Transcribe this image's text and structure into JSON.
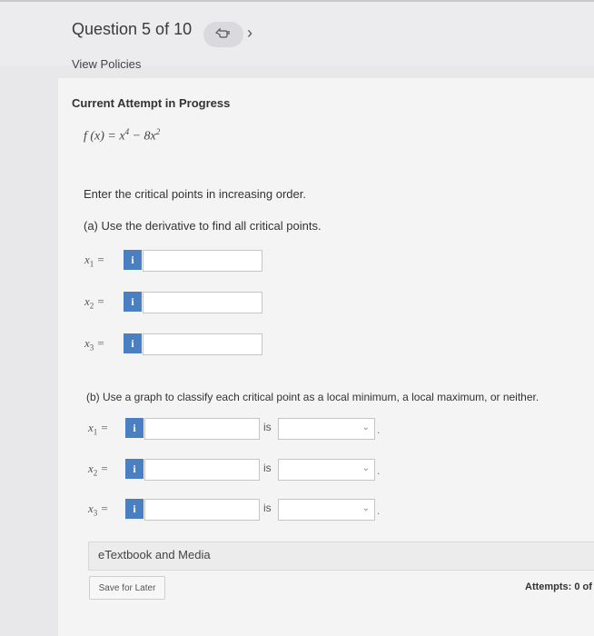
{
  "header": {
    "question_label": "Question 5 of 10",
    "view_policies": "View Policies",
    "next_icon": "chevron-right-icon",
    "hand_icon": "hand-icon"
  },
  "problem": {
    "attempt_title": "Current Attempt in Progress",
    "function_lhs": "f (x) = x",
    "function_exp1": "4",
    "function_mid": " − 8x",
    "function_exp2": "2",
    "instruction": "Enter the critical points in increasing order.",
    "part_a": "(a) Use the derivative to find all critical points.",
    "part_b": "(b) Use a graph to classify each critical point as a local minimum, a local maximum, or neither."
  },
  "part_a_rows": [
    {
      "var": "x",
      "sub": "1",
      "eq": " =",
      "badge": "i",
      "value": ""
    },
    {
      "var": "x",
      "sub": "2",
      "eq": " =",
      "badge": "i",
      "value": ""
    },
    {
      "var": "x",
      "sub": "3",
      "eq": " =",
      "badge": "i",
      "value": ""
    }
  ],
  "part_b_rows": [
    {
      "var": "x",
      "sub": "1",
      "eq": " =",
      "badge": "i",
      "value": "",
      "is_text": "is",
      "select_value": "",
      "dot": "."
    },
    {
      "var": "x",
      "sub": "2",
      "eq": " =",
      "badge": "i",
      "value": "",
      "is_text": "is",
      "select_value": "",
      "dot": "."
    },
    {
      "var": "x",
      "sub": "3",
      "eq": " =",
      "badge": "i",
      "value": "",
      "is_text": "is",
      "select_value": "",
      "dot": "."
    }
  ],
  "footer": {
    "etextbook": "eTextbook and Media",
    "save_button": "Save for Later",
    "attempts": "Attempts: 0 of"
  }
}
